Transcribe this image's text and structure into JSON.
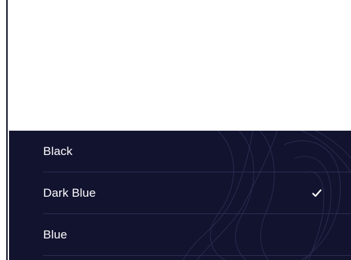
{
  "menu": {
    "items": [
      {
        "label": "Black",
        "selected": false
      },
      {
        "label": "Dark Blue",
        "selected": true
      },
      {
        "label": "Blue",
        "selected": false
      }
    ],
    "check_icon": "checkmark-icon"
  },
  "colors": {
    "panel_bg": "#12132f",
    "divider": "#2c2e52",
    "text": "#ffffff"
  }
}
